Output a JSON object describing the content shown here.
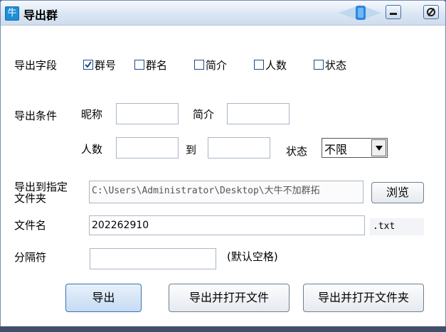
{
  "window": {
    "title": "导出群",
    "app_icon_char": "牛"
  },
  "fields": {
    "label": "导出字段",
    "options": [
      {
        "label": "群号",
        "checked": true
      },
      {
        "label": "群名",
        "checked": false
      },
      {
        "label": "简介",
        "checked": false
      },
      {
        "label": "人数",
        "checked": false
      },
      {
        "label": "状态",
        "checked": false
      }
    ]
  },
  "conditions": {
    "label": "导出条件",
    "nickname_label": "昵称",
    "nickname_value": "",
    "intro_label": "简介",
    "intro_value": "",
    "count_label": "人数",
    "count_from": "",
    "to_label": "到",
    "count_to": "",
    "status_label": "状态",
    "status_value": "不限"
  },
  "export_path": {
    "label_line1": "导出到指定",
    "label_line2": "文件夹",
    "value": "C:\\Users\\Administrator\\Desktop\\大牛不加群拓",
    "browse_label": "浏览"
  },
  "filename": {
    "label": "文件名",
    "value": "202262910",
    "extension": ".txt"
  },
  "separator": {
    "label": "分隔符",
    "value": "",
    "hint": "(默认空格)"
  },
  "buttons": {
    "export": "导出",
    "export_open_file": "导出并打开文件",
    "export_open_folder": "导出并打开文件夹"
  },
  "colors": {
    "title_bar": "#dbe6f3",
    "accent": "#1f8fd6",
    "primary_button": "#c6dbf3"
  }
}
